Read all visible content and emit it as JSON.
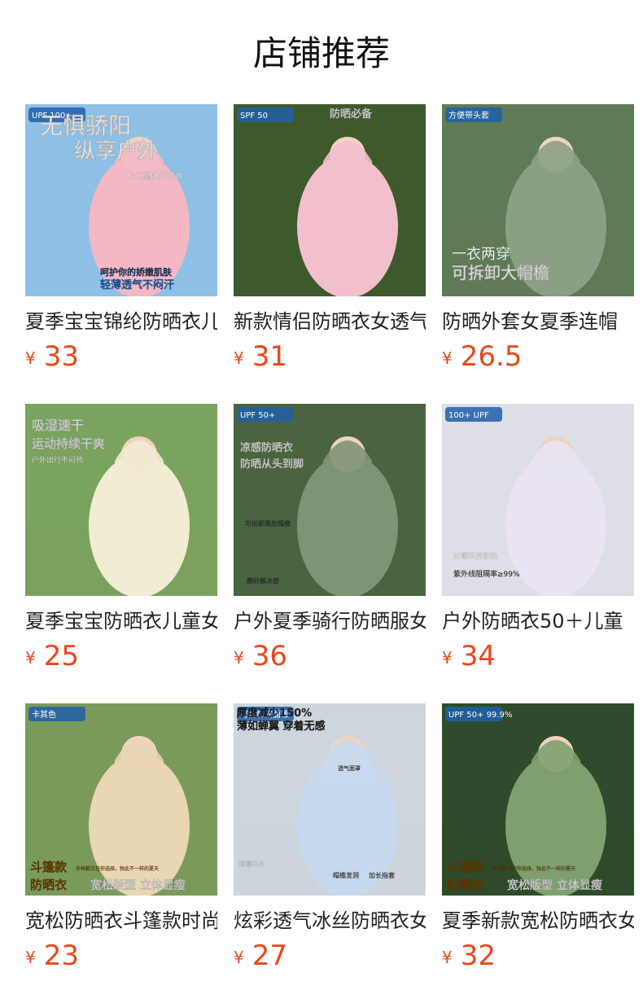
{
  "header": {
    "title": "店铺推荐"
  },
  "currency": "¥",
  "products": [
    {
      "title": "夏季宝宝锦纶防晒衣儿童",
      "price": "33",
      "image": {
        "bg": "#8fc0e6",
        "garment": "#f3b8c4",
        "badge": "UPF 100+",
        "texts": [
          "无惧骄阳",
          "纵享户外",
          "七色星期防晒衣",
          "呵护你的娇嫩肌肤",
          "轻薄透气不闷汗"
        ]
      }
    },
    {
      "title": "新款情侣防晒衣女透气",
      "price": "31",
      "image": {
        "bg": "#3e5a2c",
        "garment": "#f2bfcc",
        "badge": "SPF 50",
        "texts": [
          "防晒必备"
        ]
      }
    },
    {
      "title": "防晒外套女夏季连帽",
      "price": "26.5",
      "image": {
        "bg": "#5f7a56",
        "garment": "#8aa083",
        "badge": "方便带头套",
        "texts": [
          "一衣两穿",
          "可拆卸大帽檐"
        ]
      }
    },
    {
      "title": "夏季宝宝防晒衣儿童女",
      "price": "25",
      "image": {
        "bg": "#7aa35e",
        "garment": "#f2ecd2",
        "badge": "",
        "texts": [
          "吸湿速干",
          "运动持续干爽",
          "户外出行不闷热"
        ]
      }
    },
    {
      "title": "户外夏季骑行防晒服女",
      "price": "36",
      "image": {
        "bg": "#4b6440",
        "garment": "#7f9475",
        "badge": "UPF 50+",
        "texts": [
          "凉感防晒衣",
          "防晒从头到脚",
          "可拆卸黑胶帽檐",
          "磨砂触冰感"
        ]
      }
    },
    {
      "title": "户外防晒衣50＋儿童",
      "price": "34",
      "image": {
        "bg": "#dedfe6",
        "garment": "#e9e3f2",
        "badge": "100+ UPF",
        "texts": [
          "冰感科技散热",
          "紫外线阻隔率≥99%"
        ]
      }
    },
    {
      "title": "宽松防晒衣斗篷款时尚",
      "price": "23",
      "image": {
        "bg": "#7a9a5c",
        "garment": "#e9d6b2",
        "badge": "卡其色",
        "texts": [
          "斗篷款",
          "防晒衣",
          "宽松版型 立体显瘦",
          "多种款式任你选择，独此不一样的夏天"
        ]
      }
    },
    {
      "title": "炫彩透气冰丝防晒衣女",
      "price": "27",
      "image": {
        "bg": "#cdd6dc",
        "garment": "#c7d9ee",
        "badge": "可拆卸式面罩",
        "texts": [
          "厚度减少150%",
          "薄如蝉翼 穿着无感",
          "超薄科技",
          "透气面罩",
          "帽檐发洞",
          "加长指套"
        ]
      }
    },
    {
      "title": "夏季新款宽松防晒衣女",
      "price": "32",
      "image": {
        "bg": "#2f4a2c",
        "garment": "#7ea06e",
        "badge": "UPF 50+ 99.9%",
        "texts": [
          "斗篷款",
          "防晒衣",
          "宽松版型 立体显瘦",
          "多种款式任你选择，独此不一样的夏天"
        ]
      }
    }
  ]
}
